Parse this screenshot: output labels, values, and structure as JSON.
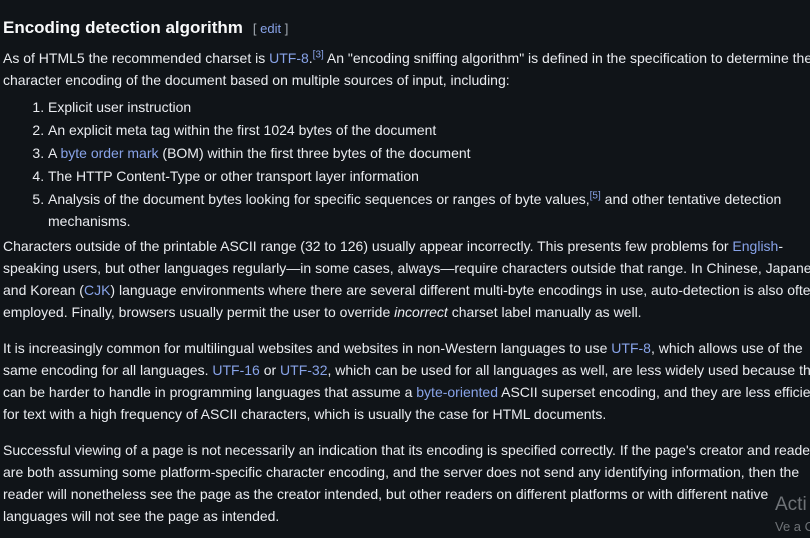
{
  "heading": {
    "title": "Encoding detection algorithm",
    "bracket_open": "[ ",
    "edit": "edit",
    "bracket_close": " ]"
  },
  "p1": {
    "t1": "As of HTML5 the recommended charset is ",
    "link_utf8": "UTF-8",
    "t2": ".",
    "ref": "[3]",
    "t3": " An \"encoding sniffing algorithm\" is defined in the specification to determine the character encoding of the document based on multiple sources of input, including:"
  },
  "list": {
    "item1": "Explicit user instruction",
    "item2": "An explicit meta tag within the first 1024 bytes of the document",
    "item3_a": "A ",
    "item3_link": "byte order mark",
    "item3_b": " (BOM) within the first three bytes of the document",
    "item4": "The HTTP Content-Type or other transport layer information",
    "item5_a": "Analysis of the document bytes looking for specific sequences or ranges of byte values,",
    "item5_ref": "[5]",
    "item5_b": " and other tentative detection mechanisms."
  },
  "p2": {
    "t1": "Characters outside of the printable ASCII range (32 to 126) usually appear incorrectly. This presents few problems for ",
    "link_english": "English",
    "t2": "-speaking users, but other languages regularly—in some cases, always—require characters outside that range. In Chinese, Japanese, and Korean (",
    "link_cjk": "CJK",
    "t3": ") language environments where there are several different multi-byte encodings in use, auto-detection is also often employed. Finally, browsers usually permit the user to override ",
    "em": "incorrect",
    "t4": " charset label manually as well."
  },
  "p3": {
    "t1": "It is increasingly common for multilingual websites and websites in non-Western languages to use ",
    "link_utf8": "UTF-8",
    "t2": ", which allows use of the same encoding for all languages. ",
    "link_utf16": "UTF-16",
    "t3": " or ",
    "link_utf32": "UTF-32",
    "t4": ", which can be used for all languages as well, are less widely used because they can be harder to handle in programming languages that assume a ",
    "link_byte": "byte-oriented",
    "t5": " ASCII superset encoding, and they are less efficient for text with a high frequency of ASCII characters, which is usually the case for HTML documents."
  },
  "p4": {
    "t1": "Successful viewing of a page is not necessarily an indication that its encoding is specified correctly. If the page's creator and reader are both assuming some platform-specific character encoding, and the server does not send any identifying information, then the reader will nonetheless see the page as the creator intended, but other readers on different platforms or with different native languages will not see the page as intended."
  },
  "watermark": {
    "line1": "Acti",
    "line2": "Ve a C"
  }
}
